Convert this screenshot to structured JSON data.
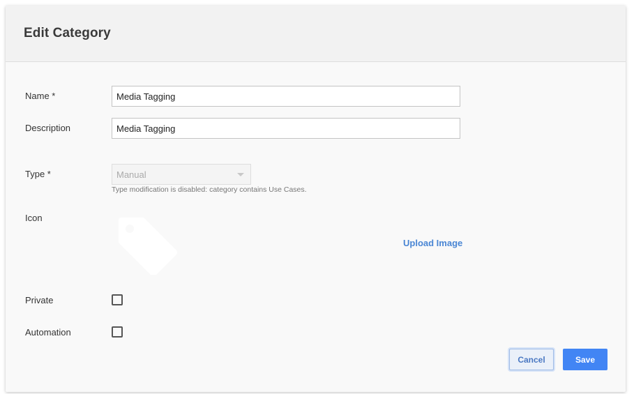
{
  "dialog": {
    "title": "Edit Category"
  },
  "form": {
    "name_label": "Name *",
    "name_value": "Media Tagging",
    "description_label": "Description",
    "description_value": "Media Tagging",
    "type_label": "Type *",
    "type_value": "Manual",
    "type_hint": "Type modification is disabled: category contains Use Cases.",
    "icon_label": "Icon",
    "icon_name": "tag-icon",
    "upload_label": "Upload Image",
    "private_label": "Private",
    "private_checked": false,
    "automation_label": "Automation",
    "automation_checked": false
  },
  "actions": {
    "cancel_label": "Cancel",
    "save_label": "Save"
  },
  "colors": {
    "primary": "#4285f4",
    "link": "#4a86d4",
    "header_bg": "#f2f2f2",
    "body_bg": "#f9f9f9"
  }
}
